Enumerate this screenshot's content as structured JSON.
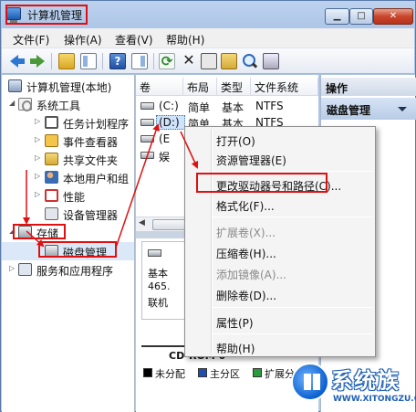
{
  "window": {
    "title": "计算机管理",
    "min_label": "▁",
    "max_label": "□",
    "close_label": "✕"
  },
  "menubar": [
    "文件(F)",
    "操作(A)",
    "查看(V)",
    "帮助(H)"
  ],
  "tree": {
    "root": "计算机管理(本地)",
    "system_tools": "系统工具",
    "task_scheduler": "任务计划程序",
    "event_viewer": "事件查看器",
    "shared_folders": "共享文件夹",
    "local_users": "本地用户和组",
    "performance": "性能",
    "device_manager": "设备管理器",
    "storage": "存储",
    "disk_management": "磁盘管理",
    "services_apps": "服务和应用程序"
  },
  "volumes": {
    "headers": [
      "卷",
      "布局",
      "类型",
      "文件系统"
    ],
    "rows": [
      [
        "(C:)",
        "简单",
        "基本",
        "NTFS"
      ],
      [
        "(D:)",
        "简单",
        "基本",
        "NTFS"
      ],
      [
        "(E",
        "",
        "",
        ""
      ],
      [
        "娱",
        "",
        "",
        ""
      ]
    ]
  },
  "disk_info": {
    "kind": "基本",
    "size": "465.",
    "status": "联机"
  },
  "cdrom": "CD-ROM 0",
  "legend": [
    {
      "label": "未分配",
      "color": "#000000"
    },
    {
      "label": "主分区",
      "color": "#1e4fb0"
    },
    {
      "label": "扩展分区",
      "color": "#2a9a3a"
    }
  ],
  "actions": {
    "header": "操作",
    "section": "磁盘管理"
  },
  "context_menu": {
    "open": "打开(O)",
    "explorer": "资源管理器(E)",
    "change_letter": "更改驱动器号和路径(C)...",
    "format": "格式化(F)...",
    "extend": "扩展卷(X)...",
    "shrink": "压缩卷(H)...",
    "add_mirror": "添加镜像(A)...",
    "delete": "删除卷(D)...",
    "properties": "属性(P)",
    "help": "帮助(H)"
  },
  "watermark": {
    "title": "系统族",
    "url": "WWW.XITONGZU.COM"
  },
  "colors": {
    "highlight": "#e01010",
    "selection": "#cfe3fb"
  }
}
